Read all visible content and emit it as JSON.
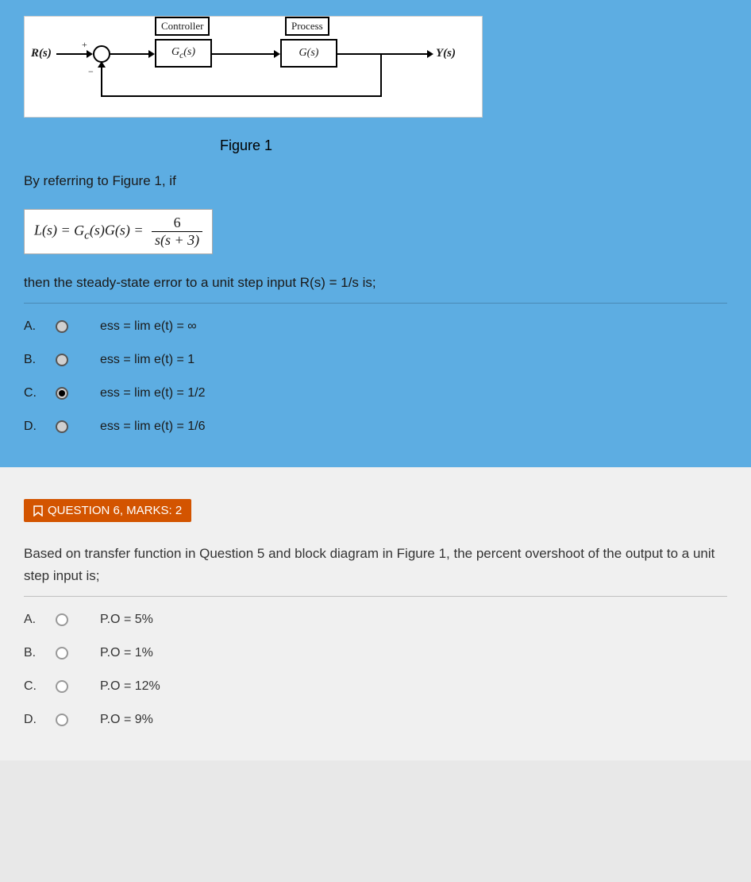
{
  "q5": {
    "diagram": {
      "input_label": "R(s)",
      "controller_title": "Controller",
      "controller_tf": "G_c(s)",
      "process_title": "Process",
      "process_tf": "G(s)",
      "output_label": "Y(s)",
      "plus": "+",
      "minus": "−"
    },
    "figure_caption": "Figure 1",
    "intro_text": "By referring to Figure 1, if",
    "formula_lhs": "L(s) = G_c(s)G(s) = ",
    "formula_num": "6",
    "formula_den": "s(s + 3)",
    "followup_text": "then the steady-state error to a unit step input R(s) = 1/s is;",
    "options": [
      {
        "letter": "A.",
        "text": "ess = lim e(t) = ∞",
        "selected": false
      },
      {
        "letter": "B.",
        "text": "ess = lim e(t) = 1",
        "selected": false
      },
      {
        "letter": "C.",
        "text": "ess = lim e(t) = 1/2",
        "selected": true
      },
      {
        "letter": "D.",
        "text": "ess = lim e(t) = 1/6",
        "selected": false
      }
    ]
  },
  "q6": {
    "badge": "QUESTION 6, MARKS: 2",
    "text": "Based on transfer function in Question 5 and block diagram in Figure 1, the percent overshoot of the output to a unit step input is;",
    "options": [
      {
        "letter": "A.",
        "text": "P.O = 5%",
        "selected": false
      },
      {
        "letter": "B.",
        "text": "P.O = 1%",
        "selected": false
      },
      {
        "letter": "C.",
        "text": "P.O = 12%",
        "selected": false
      },
      {
        "letter": "D.",
        "text": "P.O = 9%",
        "selected": false
      }
    ]
  }
}
